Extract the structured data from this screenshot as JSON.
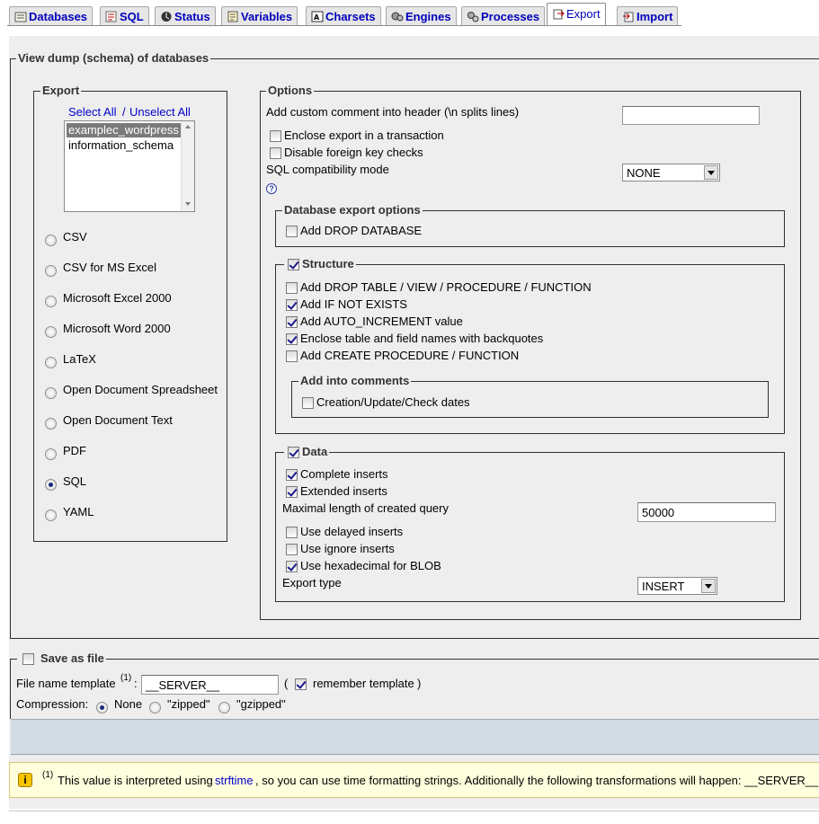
{
  "tabs": [
    {
      "label": "Databases",
      "icon": "databases-icon"
    },
    {
      "label": "SQL",
      "icon": "sql-icon"
    },
    {
      "label": "Status",
      "icon": "status-icon"
    },
    {
      "label": "Variables",
      "icon": "variables-icon"
    },
    {
      "label": "Charsets",
      "icon": "charsets-icon"
    },
    {
      "label": "Engines",
      "icon": "engines-icon"
    },
    {
      "label": "Processes",
      "icon": "processes-icon"
    },
    {
      "label": "Export",
      "icon": "export-icon",
      "active": true
    },
    {
      "label": "Import",
      "icon": "import-icon"
    }
  ],
  "main": {
    "legend": "View dump (schema) of databases",
    "export": {
      "legend": "Export",
      "select_all": "Select All",
      "separator": "/",
      "unselect_all": "Unselect All",
      "databases": [
        "examplec_wordpress",
        "information_schema"
      ],
      "selected_database": "examplec_wordpress",
      "formats": [
        "CSV",
        "CSV for MS Excel",
        "Microsoft Excel 2000",
        "Microsoft Word 2000",
        "LaTeX",
        "Open Document Spreadsheet",
        "Open Document Text",
        "PDF",
        "SQL",
        "YAML"
      ],
      "selected_format": "SQL"
    },
    "options": {
      "legend": "Options",
      "custom_comment_label": "Add custom comment into header (\\n splits lines)",
      "custom_comment_value": "",
      "enclose_transaction": {
        "label": "Enclose export in a transaction",
        "checked": false
      },
      "disable_fk": {
        "label": "Disable foreign key checks",
        "checked": false
      },
      "compat_label": "SQL compatibility mode",
      "compat_value": "NONE",
      "help_icon": "help-icon",
      "db_export": {
        "legend": "Database export options",
        "drop_database": {
          "label": "Add DROP DATABASE",
          "checked": false
        }
      },
      "structure": {
        "legend": "Structure",
        "checked": true,
        "drop_table": {
          "label": "Add DROP TABLE / VIEW / PROCEDURE / FUNCTION",
          "checked": false
        },
        "if_not_exists": {
          "label": "Add IF NOT EXISTS",
          "checked": true
        },
        "auto_increment": {
          "label": "Add AUTO_INCREMENT value",
          "checked": true
        },
        "backquotes": {
          "label": "Enclose table and field names with backquotes",
          "checked": true
        },
        "create_procedure": {
          "label": "Add CREATE PROCEDURE / FUNCTION",
          "checked": false
        },
        "comments": {
          "legend": "Add into comments",
          "dates": {
            "label": "Creation/Update/Check dates",
            "checked": false
          }
        }
      },
      "data": {
        "legend": "Data",
        "checked": true,
        "complete_inserts": {
          "label": "Complete inserts",
          "checked": true
        },
        "extended_inserts": {
          "label": "Extended inserts",
          "checked": true
        },
        "max_length_label": "Maximal length of created query",
        "max_length_value": "50000",
        "delayed_inserts": {
          "label": "Use delayed inserts",
          "checked": false
        },
        "ignore_inserts": {
          "label": "Use ignore inserts",
          "checked": false
        },
        "hex_blob": {
          "label": "Use hexadecimal for BLOB",
          "checked": true
        },
        "export_type_label": "Export type",
        "export_type_value": "INSERT"
      }
    }
  },
  "save": {
    "legend": "Save as file",
    "checked": false,
    "template_label": "File name template",
    "footnote_mark": "(1)",
    "colon": ":",
    "template_value": "__SERVER__",
    "paren_open": "(",
    "remember_label": "remember template",
    "remember_checked": true,
    "paren_close": ")",
    "compression_label": "Compression:",
    "compression_options": [
      "None",
      "\"zipped\"",
      "\"gzipped\""
    ],
    "compression_selected": "None"
  },
  "notice": {
    "icon": "info-icon",
    "footnote_mark": "(1)",
    "text_before": "This value is interpreted using",
    "link": "strftime",
    "text_after": ", so you can use time formatting strings. Additionally the following transformations will happen: __SERVER__"
  }
}
